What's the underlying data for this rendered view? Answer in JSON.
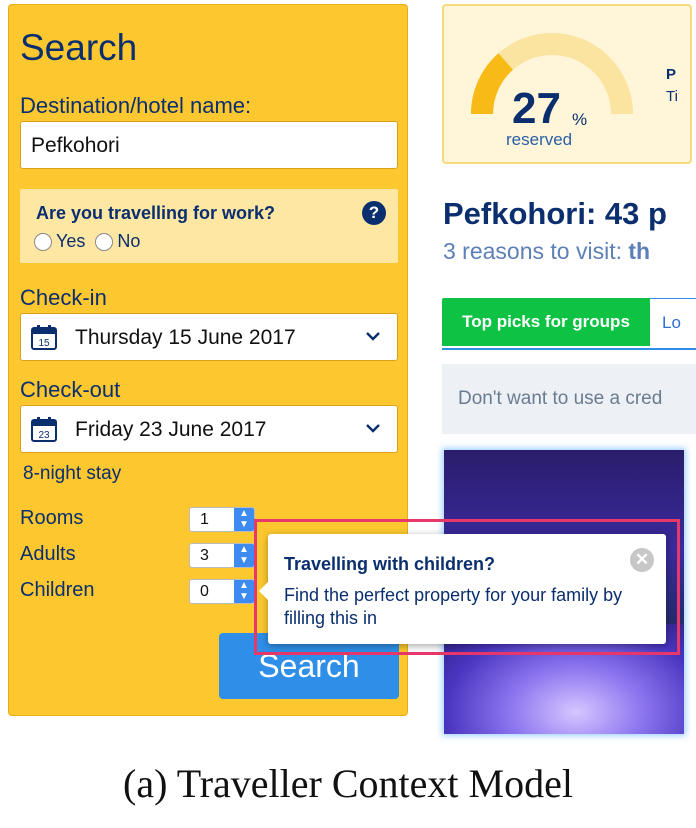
{
  "search_panel": {
    "title": "Search",
    "destination_label": "Destination/hotel name:",
    "destination_value": "Pefkohori",
    "work_question": "Are you travelling for work?",
    "help_glyph": "?",
    "work_options": [
      "Yes",
      "No"
    ],
    "checkin_label": "Check-in",
    "checkin_day": "15",
    "checkin_value": "Thursday 15 June 2017",
    "checkout_label": "Check-out",
    "checkout_day": "23",
    "checkout_value": "Friday 23 June 2017",
    "night_stay": "8-night stay",
    "rooms_label": "Rooms",
    "rooms_value": "1",
    "adults_label": "Adults",
    "adults_value": "3",
    "children_label": "Children",
    "children_value": "0",
    "search_button": "Search"
  },
  "reserved_card": {
    "value": "27",
    "unit": "%",
    "label": "reserved",
    "level_percent": 27,
    "side_line1": "P",
    "side_line2": "Ti"
  },
  "destination": {
    "title": "Pefkohori: 43 p",
    "subtitle_prefix": "3 reasons to visit: ",
    "subtitle_bold": "th"
  },
  "tabs": {
    "active": "Top picks for groups",
    "other": "Lo"
  },
  "notice": "Don't want to use a cred",
  "tooltip": {
    "title": "Travelling with children?",
    "body": "Find the perfect property for your family by filling this in",
    "close_glyph": "✕"
  },
  "caption": "(a)  Traveller Context Model",
  "colors": {
    "panel": "#FDC82F",
    "navy": "#0b2e6e",
    "search_button": "#2f8fe8",
    "tab_active": "#0ec244",
    "highlight": "#e8386b"
  }
}
